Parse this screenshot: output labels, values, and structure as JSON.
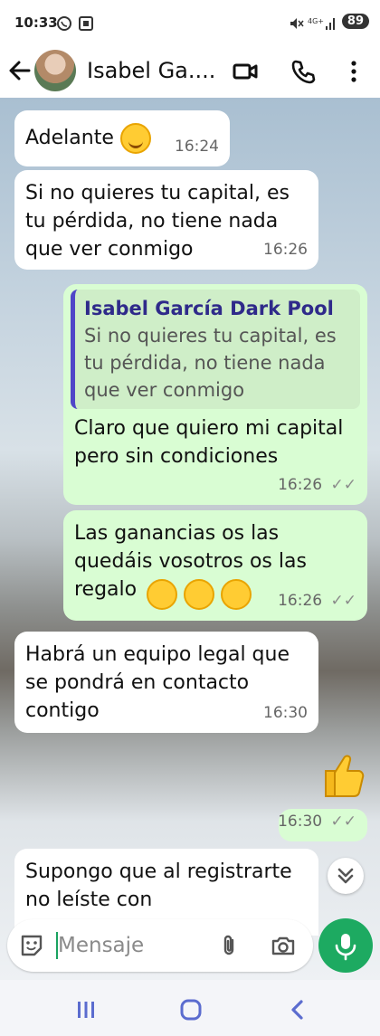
{
  "status_bar": {
    "time": "10:33",
    "battery": "89"
  },
  "header": {
    "contact_name": "Isabel Ga...."
  },
  "messages": [
    {
      "dir": "in",
      "text": "Adelante",
      "time": "16:24"
    },
    {
      "dir": "in",
      "text": "Si no quieres tu capital, es tu pérdida, no tiene nada que ver conmigo",
      "time": "16:26"
    },
    {
      "dir": "out",
      "quote_name": "Isabel García Dark Pool",
      "quote_text": "Si no quieres tu capital, es tu pérdida, no tiene nada que ver conmigo",
      "text": "Claro que quiero mi capital pero sin condiciones",
      "time": "16:26"
    },
    {
      "dir": "out",
      "text": "Las ganancias os las quedáis vosotros os las regalo",
      "time": "16:26"
    },
    {
      "dir": "in",
      "text": "Habrá un equipo legal que se pondrá en contacto contigo",
      "time": "16:30"
    },
    {
      "dir": "out",
      "text": "",
      "time": "16:30"
    },
    {
      "dir": "in",
      "text": "Supongo que al registrarte no leíste con",
      "time": ""
    }
  ],
  "input": {
    "placeholder": "Mensaje"
  },
  "icons": {
    "back": "arrow-left-icon",
    "video": "video-camera-icon",
    "call": "phone-icon",
    "menu": "more-vertical-icon",
    "sticker": "sticker-icon",
    "attach": "paperclip-icon",
    "camera": "camera-icon",
    "mic": "microphone-icon",
    "scroll": "double-chevron-down-icon",
    "smile": "smiling-face-emoji",
    "laugh": "rolling-laughing-emoji",
    "thumb": "thumbs-up-emoji"
  },
  "colors": {
    "outgoing": "#d9fdd3",
    "incoming": "#ffffff",
    "accent": "#1daa61",
    "quote_bar": "#4f46c8"
  }
}
